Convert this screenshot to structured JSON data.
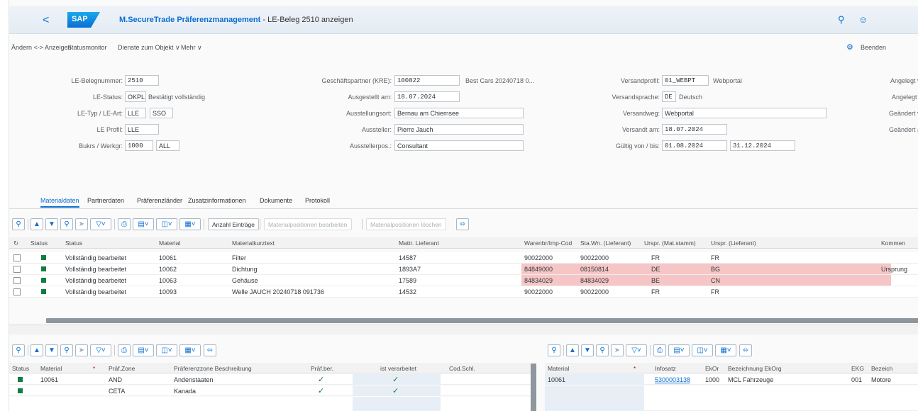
{
  "titlebar": {
    "back_symbol": "<",
    "logo": "SAP",
    "title_bold": "M.SecureTrade Präferenzmanagement",
    "title_rest": " - LE-Beleg 2510 anzeigen"
  },
  "toolbar": {
    "toggle": "Ändern <-> Anzeigen",
    "status_monitor": "Statusmonitor",
    "services": "Dienste zum Objekt ∨",
    "more": "Mehr ∨",
    "exit": "Beenden"
  },
  "header": {
    "col1": {
      "belegnummer_label": "LE-Belegnummer:",
      "belegnummer": "2510",
      "status_label": "LE-Status:",
      "status_code": "OKPL",
      "status_text": "Bestätigt vollständig",
      "typ_label": "LE-Typ / LE-Art:",
      "typ": "LLE",
      "art": "SSO",
      "profil_label": "LE Profil:",
      "profil": "LLE",
      "bukrs_label": "Bukrs / Werkgr:",
      "bukrs": "1000",
      "werkgr": "ALL"
    },
    "col2": {
      "partner_label": "Geschäftspartner (KRE):",
      "partner": "100822",
      "partner_text": "Best Cars 20240718 0...",
      "ausgestellt_label": "Ausgestellt am:",
      "ausgestellt": "18.07.2024",
      "ort_label": "Ausstellungsort:",
      "ort": "Bernau am Chiemsee",
      "aussteller_label": "Aussteller:",
      "aussteller": "Pierre Jauch",
      "position_label": "Ausstellerpos.:",
      "position": "Consultant"
    },
    "col3": {
      "profil_label": "Versandprofil:",
      "profil": "01_WEBPT",
      "profil_text": "Webportal",
      "sprache_label": "Versandsprache:",
      "sprache": "DE",
      "sprache_text": "Deutsch",
      "weg_label": "Versandweg:",
      "weg": "Webportal",
      "versand_label": "Versandt am:",
      "versand": "18.07.2024",
      "gueltig_label": "Gültig von / bis:",
      "gueltig_von": "01.08.2024",
      "gueltig_bis": "31.12.2024"
    },
    "col4": {
      "l1": "Angelegt v",
      "l2": "Angelegt a",
      "l3": "Geändert v",
      "l4": "Geändert a"
    }
  },
  "tabs": [
    "Materialdaten",
    "Partnerdaten",
    "Präferenzländer",
    "Zusatzinformationen",
    "Dokumente",
    "Protokoll"
  ],
  "grid1_toolbar": {
    "show_entries": "Anzahl Einträge",
    "edit_positions": "Materialpositionen bearbeiten",
    "delete_positions": "Materialpositionen löschen"
  },
  "table1": {
    "headers": [
      "Status",
      "Status",
      "Material",
      "Materialkurztext",
      "Mattr. Lieferant",
      "Warenbr/Imp-Cod",
      "Sta.Wn. (Lieferant)",
      "Urspr. (Mat.stamm)",
      "Urspr. (Lieferant)",
      "Kommen"
    ],
    "rows": [
      {
        "status": "Vollständig bearbeitet",
        "material": "10061",
        "text": "Filter",
        "lief": "14587",
        "code": "90022000",
        "sta": "90022000",
        "u1": "FR",
        "u2": "FR",
        "komm": ""
      },
      {
        "status": "Vollständig bearbeitet",
        "material": "10062",
        "text": "Dichtung",
        "lief": "1893A7",
        "code": "84849000",
        "sta": "08150814",
        "u1": "DE",
        "u2": "BG",
        "komm": "Ursprung"
      },
      {
        "status": "Vollständig bearbeitet",
        "material": "10063",
        "text": "Gehäuse",
        "lief": "17589",
        "code": "84834029",
        "sta": "84834029",
        "u1": "BE",
        "u2": "CN",
        "komm": ""
      },
      {
        "status": "Vollständig bearbeitet",
        "material": "10093",
        "text": "Welle JAUCH 20240718 091736",
        "lief": "14532",
        "code": "90022000",
        "sta": "90022000",
        "u1": "FR",
        "u2": "FR",
        "komm": ""
      }
    ]
  },
  "table2": {
    "headers": [
      "Status",
      "Material",
      "Präf.Zone",
      "Präferenzzone Beschreibung",
      "Präf.ber.",
      "ist verarbeitet",
      "Cod.Schl."
    ],
    "rows": [
      {
        "material": "10061",
        "zone": "AND",
        "desc": "Andenstaaten",
        "ber": "✓",
        "ist": "✓"
      },
      {
        "material": "",
        "zone": "CETA",
        "desc": "Kanada",
        "ber": "✓",
        "ist": "✓"
      }
    ]
  },
  "table3": {
    "headers": [
      "Material",
      "Infosatz",
      "EkOr",
      "Bezeichnung EkOrg",
      "EKG",
      "Bezeich"
    ],
    "rows": [
      {
        "material": "10061",
        "infosatz": "5300003138",
        "ekor": "1000",
        "bez": "MCL Fahrzeuge",
        "ekg": "001",
        "bez2": "Motore"
      }
    ]
  },
  "colors": {
    "accent": "#0a6ed1",
    "ok": "#107e3e",
    "error_bg": "#f6c6c6"
  }
}
